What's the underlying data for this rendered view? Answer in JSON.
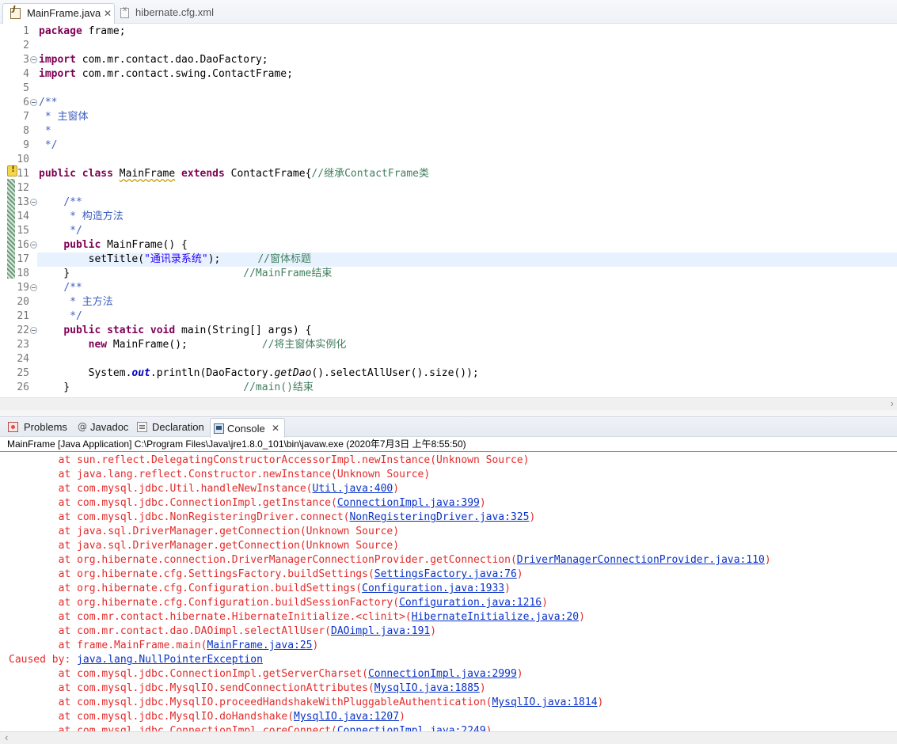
{
  "editor": {
    "tabs": [
      {
        "label": "MainFrame.java",
        "icon": "java-file-icon",
        "active": true,
        "close": "✕"
      },
      {
        "label": "hibernate.cfg.xml",
        "icon": "xml-file-icon",
        "active": false
      }
    ],
    "current_line": 17,
    "lines": [
      {
        "n": "1",
        "fold": false,
        "seg": [
          {
            "c": "kw",
            "t": "package"
          },
          {
            "c": "",
            "t": " frame;"
          }
        ]
      },
      {
        "n": "2",
        "fold": false,
        "seg": []
      },
      {
        "n": "3",
        "fold": true,
        "seg": [
          {
            "c": "kw",
            "t": "import"
          },
          {
            "c": "",
            "t": " com.mr.contact.dao.DaoFactory;"
          }
        ]
      },
      {
        "n": "4",
        "fold": false,
        "seg": [
          {
            "c": "kw",
            "t": "import"
          },
          {
            "c": "",
            "t": " com.mr.contact.swing.ContactFrame;"
          }
        ]
      },
      {
        "n": "5",
        "fold": false,
        "seg": []
      },
      {
        "n": "6",
        "fold": true,
        "seg": [
          {
            "c": "jd",
            "t": "/**"
          }
        ]
      },
      {
        "n": "7",
        "fold": false,
        "seg": [
          {
            "c": "jd",
            "t": " * 主窗体"
          }
        ]
      },
      {
        "n": "8",
        "fold": false,
        "seg": [
          {
            "c": "jd",
            "t": " *"
          }
        ]
      },
      {
        "n": "9",
        "fold": false,
        "seg": [
          {
            "c": "jd",
            "t": " */"
          }
        ]
      },
      {
        "n": "10",
        "fold": false,
        "seg": []
      },
      {
        "n": "11",
        "fold": false,
        "seg": [
          {
            "c": "kw",
            "t": "public"
          },
          {
            "c": "",
            "t": " "
          },
          {
            "c": "kw",
            "t": "class"
          },
          {
            "c": "",
            "t": " "
          },
          {
            "c": "warn",
            "t": "MainFrame"
          },
          {
            "c": "",
            "t": " "
          },
          {
            "c": "kw",
            "t": "extends"
          },
          {
            "c": "",
            "t": " ContactFrame{"
          },
          {
            "c": "cm",
            "t": "//继承ContactFrame类"
          }
        ]
      },
      {
        "n": "12",
        "fold": false,
        "seg": []
      },
      {
        "n": "13",
        "fold": true,
        "seg": [
          {
            "c": "",
            "t": "    "
          },
          {
            "c": "jd",
            "t": "/**"
          }
        ]
      },
      {
        "n": "14",
        "fold": false,
        "seg": [
          {
            "c": "jd",
            "t": "     * 构造方法"
          }
        ]
      },
      {
        "n": "15",
        "fold": false,
        "seg": [
          {
            "c": "jd",
            "t": "     */"
          }
        ]
      },
      {
        "n": "16",
        "fold": true,
        "seg": [
          {
            "c": "",
            "t": "    "
          },
          {
            "c": "kw",
            "t": "public"
          },
          {
            "c": "",
            "t": " MainFrame() {"
          }
        ]
      },
      {
        "n": "17",
        "fold": false,
        "seg": [
          {
            "c": "",
            "t": "        setTitle("
          },
          {
            "c": "str",
            "t": "\"通讯录系统\""
          },
          {
            "c": "",
            "t": ");      "
          },
          {
            "c": "cm",
            "t": "//窗体标题"
          }
        ]
      },
      {
        "n": "18",
        "fold": false,
        "seg": [
          {
            "c": "",
            "t": "    }                            "
          },
          {
            "c": "cm",
            "t": "//MainFrame结束"
          }
        ]
      },
      {
        "n": "19",
        "fold": true,
        "seg": [
          {
            "c": "",
            "t": "    "
          },
          {
            "c": "jd",
            "t": "/**"
          }
        ]
      },
      {
        "n": "20",
        "fold": false,
        "seg": [
          {
            "c": "jd",
            "t": "     * 主方法"
          }
        ]
      },
      {
        "n": "21",
        "fold": false,
        "seg": [
          {
            "c": "jd",
            "t": "     */"
          }
        ]
      },
      {
        "n": "22",
        "fold": true,
        "seg": [
          {
            "c": "",
            "t": "    "
          },
          {
            "c": "kw",
            "t": "public"
          },
          {
            "c": "",
            "t": " "
          },
          {
            "c": "kw",
            "t": "static"
          },
          {
            "c": "",
            "t": " "
          },
          {
            "c": "kw",
            "t": "void"
          },
          {
            "c": "",
            "t": " main(String[] args) {"
          }
        ]
      },
      {
        "n": "23",
        "fold": false,
        "seg": [
          {
            "c": "",
            "t": "        "
          },
          {
            "c": "kw",
            "t": "new"
          },
          {
            "c": "",
            "t": " MainFrame();            "
          },
          {
            "c": "cm",
            "t": "//将主窗体实例化"
          }
        ]
      },
      {
        "n": "24",
        "fold": false,
        "seg": []
      },
      {
        "n": "25",
        "fold": false,
        "seg": [
          {
            "c": "",
            "t": "        System."
          },
          {
            "c": "st",
            "t": "out"
          },
          {
            "c": "",
            "t": ".println(DaoFactory."
          },
          {
            "c": "it",
            "t": "getDao"
          },
          {
            "c": "",
            "t": "().selectAllUser().size());"
          }
        ]
      },
      {
        "n": "26",
        "fold": false,
        "seg": [
          {
            "c": "",
            "t": "    }                            "
          },
          {
            "c": "cm",
            "t": "//main()结束"
          }
        ]
      }
    ]
  },
  "panel": {
    "tabs": [
      {
        "label": "Problems",
        "icon": "problems-icon"
      },
      {
        "label": "Javadoc",
        "icon": "javadoc-at-icon",
        "glyph": "@"
      },
      {
        "label": "Declaration",
        "icon": "declaration-icon"
      },
      {
        "label": "Console",
        "icon": "console-icon",
        "active": true,
        "close": "✕"
      }
    ],
    "console_header": "MainFrame [Java Application] C:\\Program Files\\Java\\jre1.8.0_101\\bin\\javaw.exe  (2020年7月3日 上午8:55:50)",
    "output": [
      {
        "pre": "        at sun.reflect.DelegatingConstructorAccessorImpl.newInstance(Unknown Source)",
        "link": "",
        "post": ""
      },
      {
        "pre": "        at java.lang.reflect.Constructor.newInstance(Unknown Source)",
        "link": "",
        "post": ""
      },
      {
        "pre": "        at com.mysql.jdbc.Util.handleNewInstance(",
        "link": "Util.java:400",
        "post": ")"
      },
      {
        "pre": "        at com.mysql.jdbc.ConnectionImpl.getInstance(",
        "link": "ConnectionImpl.java:399",
        "post": ")"
      },
      {
        "pre": "        at com.mysql.jdbc.NonRegisteringDriver.connect(",
        "link": "NonRegisteringDriver.java:325",
        "post": ")"
      },
      {
        "pre": "        at java.sql.DriverManager.getConnection(Unknown Source)",
        "link": "",
        "post": ""
      },
      {
        "pre": "        at java.sql.DriverManager.getConnection(Unknown Source)",
        "link": "",
        "post": ""
      },
      {
        "pre": "        at org.hibernate.connection.DriverManagerConnectionProvider.getConnection(",
        "link": "DriverManagerConnectionProvider.java:110",
        "post": ")"
      },
      {
        "pre": "        at org.hibernate.cfg.SettingsFactory.buildSettings(",
        "link": "SettingsFactory.java:76",
        "post": ")"
      },
      {
        "pre": "        at org.hibernate.cfg.Configuration.buildSettings(",
        "link": "Configuration.java:1933",
        "post": ")"
      },
      {
        "pre": "        at org.hibernate.cfg.Configuration.buildSessionFactory(",
        "link": "Configuration.java:1216",
        "post": ")"
      },
      {
        "pre": "        at com.mr.contact.hibernate.HibernateInitialize.<clinit>(",
        "link": "HibernateInitialize.java:20",
        "post": ")"
      },
      {
        "pre": "        at com.mr.contact.dao.DAOimpl.selectAllUser(",
        "link": "DAOimpl.java:191",
        "post": ")"
      },
      {
        "pre": "        at frame.MainFrame.main(",
        "link": "MainFrame.java:25",
        "post": ")"
      },
      {
        "pre": "Caused by: ",
        "link": "java.lang.NullPointerException",
        "post": ""
      },
      {
        "pre": "        at com.mysql.jdbc.ConnectionImpl.getServerCharset(",
        "link": "ConnectionImpl.java:2999",
        "post": ")"
      },
      {
        "pre": "        at com.mysql.jdbc.MysqlIO.sendConnectionAttributes(",
        "link": "MysqlIO.java:1885",
        "post": ")"
      },
      {
        "pre": "        at com.mysql.jdbc.MysqlIO.proceedHandshakeWithPluggableAuthentication(",
        "link": "MysqlIO.java:1814",
        "post": ")"
      },
      {
        "pre": "        at com.mysql.jdbc.MysqlIO.doHandshake(",
        "link": "MysqlIO.java:1207",
        "post": ")"
      },
      {
        "pre": "        at com.mysql.jdbc.ConnectionImpl.coreConnect(",
        "link": "ConnectionImpl.java:2249",
        "post": ")"
      }
    ]
  },
  "colors": {
    "keyword": "#7f0055",
    "comment": "#3f7f5f",
    "javadoc": "#3f5fbf",
    "string": "#2a00ff",
    "error_text": "#e32b2b",
    "link": "#0a32c8",
    "current_line": "#e8f2fe"
  }
}
